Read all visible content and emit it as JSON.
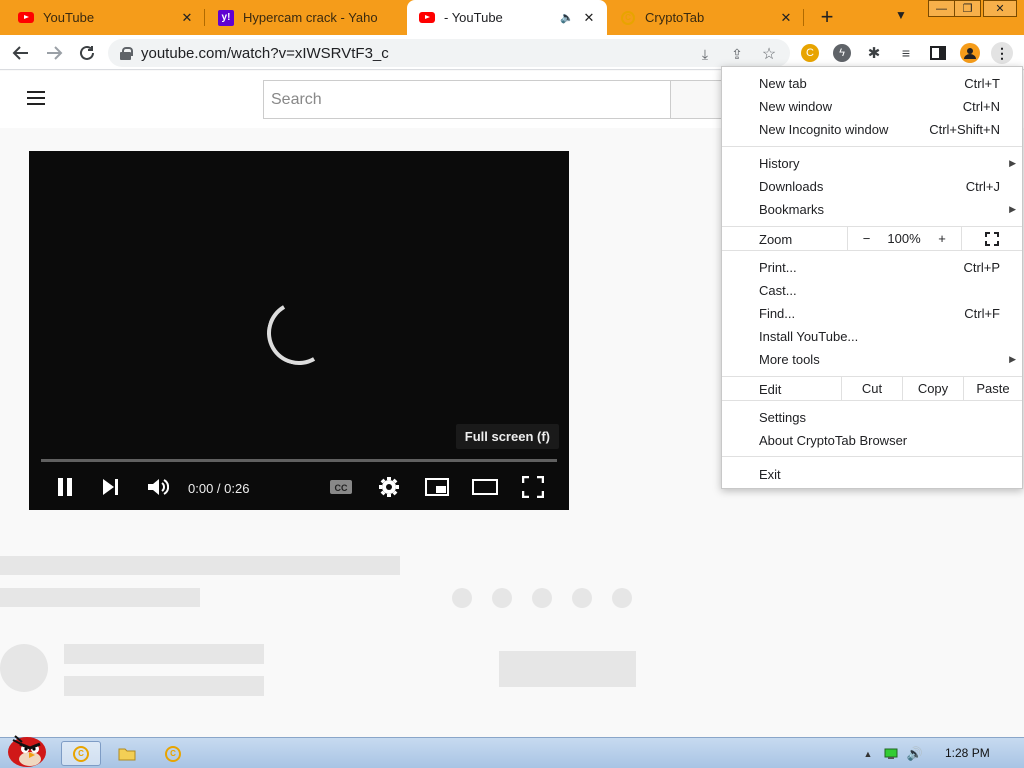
{
  "colors": {
    "tabstrip": "#f59c1a",
    "youtube_red": "#ff0000",
    "yahoo_purple": "#6001d2",
    "cryptotab_gold": "#e8a400"
  },
  "tabs": [
    {
      "title": "YouTube",
      "icon": "youtube-icon"
    },
    {
      "title": "Hypercam crack - Yaho",
      "icon": "yahoo-icon"
    },
    {
      "title": "- YouTube",
      "icon": "youtube-icon",
      "active": true
    },
    {
      "title": "CryptoTab",
      "icon": "cryptotab-icon"
    }
  ],
  "omnibox": {
    "url": "youtube.com/watch?v=xIWSRVtF3_c"
  },
  "youtube": {
    "search_placeholder": "Search",
    "tooltip": "Full screen (f)",
    "time": "0:00 / 0:26"
  },
  "menu": {
    "new_tab": {
      "label": "New tab",
      "shortcut": "Ctrl+T"
    },
    "new_window": {
      "label": "New window",
      "shortcut": "Ctrl+N"
    },
    "incognito": {
      "label": "New Incognito window",
      "shortcut": "Ctrl+Shift+N"
    },
    "history": {
      "label": "History"
    },
    "downloads": {
      "label": "Downloads",
      "shortcut": "Ctrl+J"
    },
    "bookmarks": {
      "label": "Bookmarks"
    },
    "zoom": {
      "label": "Zoom",
      "minus": "−",
      "value": "100%",
      "plus": "+"
    },
    "print": {
      "label": "Print...",
      "shortcut": "Ctrl+P"
    },
    "cast": {
      "label": "Cast..."
    },
    "find": {
      "label": "Find...",
      "shortcut": "Ctrl+F"
    },
    "install": {
      "label": "Install YouTube..."
    },
    "more_tools": {
      "label": "More tools"
    },
    "edit": {
      "label": "Edit",
      "cut": "Cut",
      "copy": "Copy",
      "paste": "Paste"
    },
    "settings": {
      "label": "Settings"
    },
    "about": {
      "label": "About CryptoTab Browser"
    },
    "exit": {
      "label": "Exit"
    }
  },
  "taskbar": {
    "clock": "1:28 PM"
  }
}
